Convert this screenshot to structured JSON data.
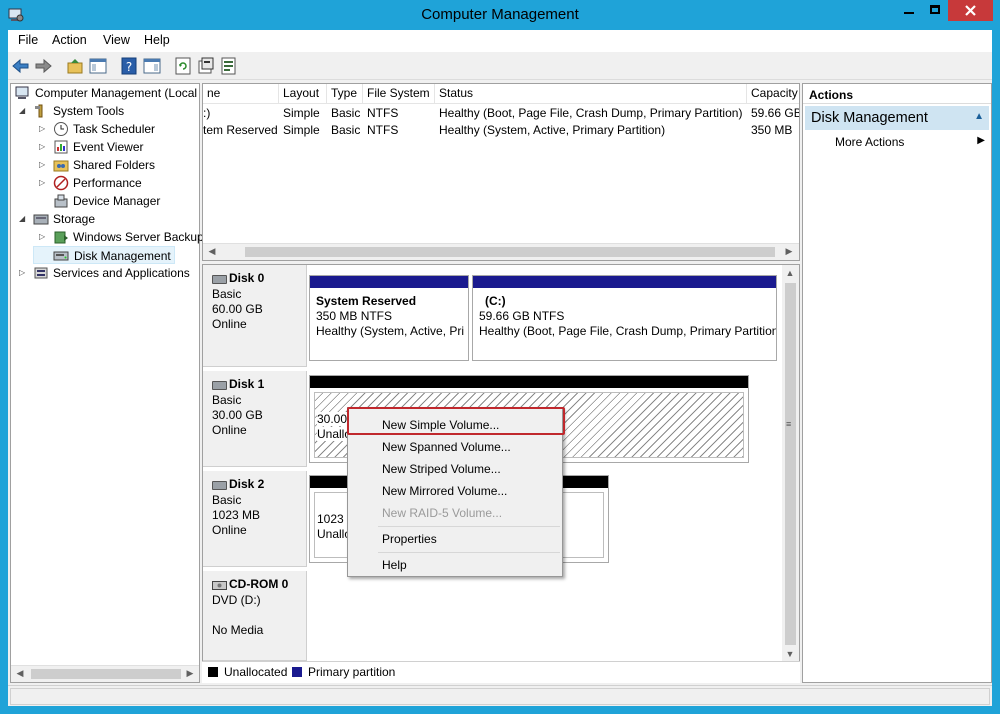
{
  "window": {
    "title": "Computer Management",
    "colors": {
      "titlebar": "#1fa3d8",
      "close": "#c7393a",
      "highlight_box": "#c0282d",
      "partition_bar": "#1a1a8f",
      "unallocated_bar": "#000000"
    }
  },
  "menu": {
    "file": "File",
    "action": "Action",
    "view": "View",
    "help": "Help"
  },
  "tree": {
    "root": "Computer Management (Local",
    "system_tools": "System Tools",
    "task_scheduler": "Task Scheduler",
    "event_viewer": "Event Viewer",
    "shared_folders": "Shared Folders",
    "performance": "Performance",
    "device_manager": "Device Manager",
    "storage": "Storage",
    "windows_server_backup": "Windows Server Backup",
    "disk_management": "Disk Management",
    "services_and_applications": "Services and Applications"
  },
  "volume_list": {
    "headers": {
      "volume": "ne",
      "layout": "Layout",
      "type": "Type",
      "file_system": "File System",
      "status": "Status",
      "capacity": "Capacity"
    },
    "rows": [
      {
        "volume": ":)",
        "layout": "Simple",
        "type": "Basic",
        "file_system": "NTFS",
        "status": "Healthy (Boot, Page File, Crash Dump, Primary Partition)",
        "capacity": "59.66 GB"
      },
      {
        "volume": "tem Reserved",
        "layout": "Simple",
        "type": "Basic",
        "file_system": "NTFS",
        "status": "Healthy (System, Active, Primary Partition)",
        "capacity": "350 MB"
      }
    ]
  },
  "disks": {
    "disk0": {
      "name": "Disk 0",
      "type": "Basic",
      "size": "60.00 GB",
      "state": "Online",
      "vol1": {
        "name": "System Reserved",
        "size": "350 MB NTFS",
        "status": "Healthy (System, Active, Pri"
      },
      "vol2": {
        "name": "(C:)",
        "size": "59.66 GB NTFS",
        "status": "Healthy (Boot, Page File, Crash Dump, Primary Partition"
      }
    },
    "disk1": {
      "name": "Disk 1",
      "type": "Basic",
      "size": "30.00 GB",
      "state": "Online",
      "vol_size": "30.00",
      "vol_status": "Unallo"
    },
    "disk2": {
      "name": "Disk 2",
      "type": "Basic",
      "size": "1023 MB",
      "state": "Online",
      "vol_size": "1023 M",
      "vol_status": "Unallo"
    },
    "cdrom0": {
      "name": "CD-ROM 0",
      "type": "DVD (D:)",
      "state": "No Media"
    }
  },
  "legend": {
    "unallocated": "Unallocated",
    "primary": "Primary partition"
  },
  "actions": {
    "header": "Actions",
    "section": "Disk Management",
    "more_actions": "More Actions"
  },
  "context_menu": {
    "new_simple": "New Simple Volume...",
    "new_spanned": "New Spanned Volume...",
    "new_striped": "New Striped Volume...",
    "new_mirrored": "New Mirrored Volume...",
    "new_raid5": "New RAID-5 Volume...",
    "properties": "Properties",
    "help": "Help"
  }
}
